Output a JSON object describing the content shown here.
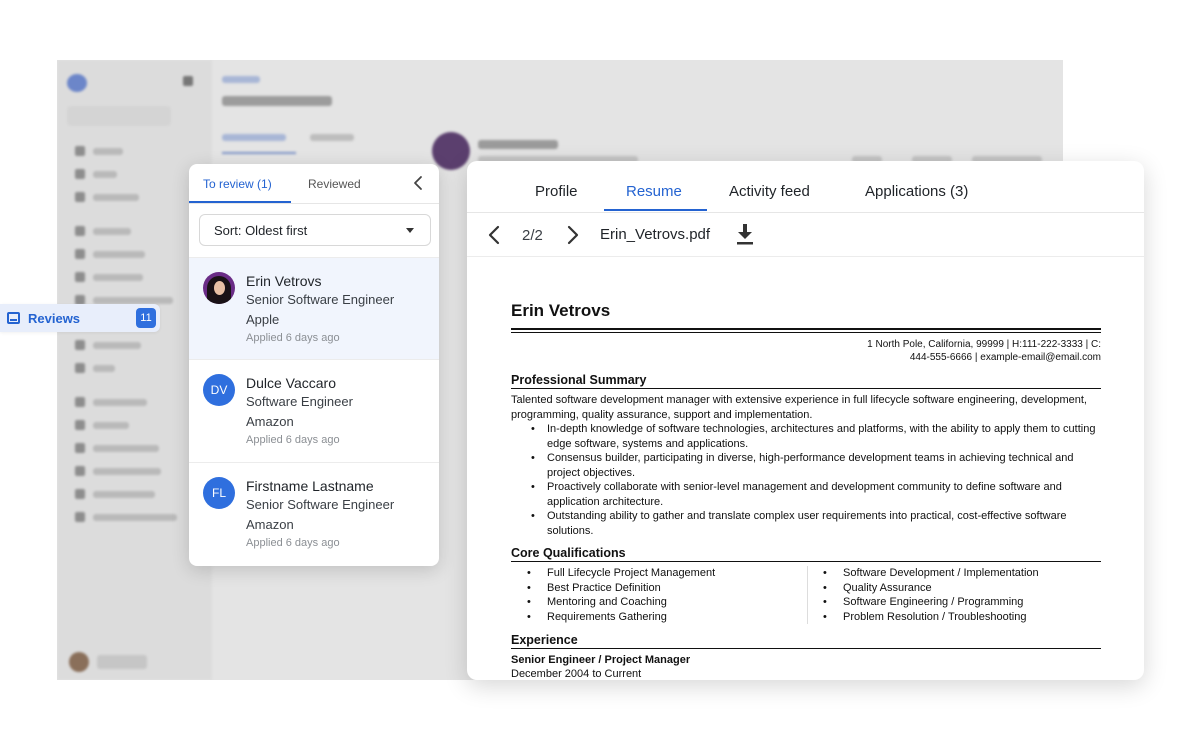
{
  "sidebar_pill": {
    "label": "Reviews",
    "count": "11"
  },
  "list_panel": {
    "tabs": [
      "To review (1)",
      "Reviewed"
    ],
    "sort_label": "Sort: Oldest first",
    "candidates": [
      {
        "name": "Erin Vetrovs",
        "role": "Senior Software Engineer",
        "company": "Apple",
        "applied": "Applied 6 days ago",
        "initials": ""
      },
      {
        "name": "Dulce Vaccaro",
        "role": "Software Engineer",
        "company": "Amazon",
        "applied": "Applied 6 days ago",
        "initials": "DV"
      },
      {
        "name": "Firstname Lastname",
        "role": "Senior Software Engineer",
        "company": "Amazon",
        "applied": "Applied 6 days ago",
        "initials": "FL"
      }
    ]
  },
  "resume_panel": {
    "tabs": [
      "Profile",
      "Resume",
      "Activity feed",
      "Applications (3)"
    ],
    "active_tab": "Resume",
    "page_indicator": "2/2",
    "file_name": "Erin_Vetrovs.pdf",
    "document": {
      "name": "Erin Vetrovs",
      "contact_line1": "1 North Pole, California, 99999 | H:111-222-3333 | C:",
      "contact_line2": "444-555-6666 | example-email@email.com",
      "summary_heading": "Professional Summary",
      "summary_text": "Talented software development manager with extensive experience in full lifecycle software engineering, development, programming, quality assurance, support and implementation.",
      "summary_bullets": [
        "In-depth knowledge of software technologies, architectures and platforms, with the ability to apply them to cutting edge software, systems and applications.",
        "Consensus builder, participating in diverse, high-performance development teams in achieving technical and project objectives.",
        "Proactively collaborate with senior-level management and development community to define software and application architecture.",
        "Outstanding ability to gather and translate complex user requirements into practical, cost-effective software solutions."
      ],
      "qualifications_heading": "Core Qualifications",
      "qualifications_left": [
        "Full Lifecycle Project Management",
        "Best Practice Definition",
        "Mentoring and Coaching",
        "Requirements Gathering"
      ],
      "qualifications_right": [
        "Software Development / Implementation",
        "Quality Assurance",
        "Software Engineering / Programming",
        "Problem Resolution / Troubleshooting"
      ],
      "experience_heading": "Experience",
      "job_title": "Senior Engineer / Project Manager",
      "job_dates": "December 2004 to Current"
    }
  },
  "colors": {
    "accent": "#2463d1",
    "badge": "#2f6fde",
    "selected_row": "#f1f5fd",
    "backdrop": "#e4e4e4"
  }
}
